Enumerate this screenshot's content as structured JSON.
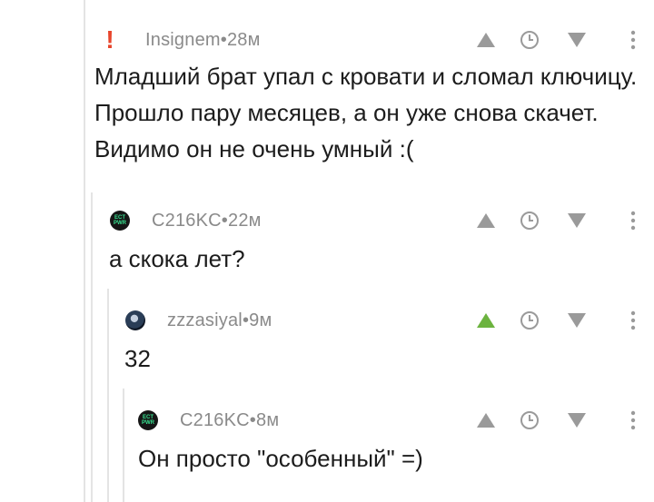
{
  "comments": [
    {
      "author": "Insignem",
      "time": "28м",
      "avatar_icon": "exclamation-icon",
      "text": "Младший брат упал с кровати и сломал ключицу. Прошло пару месяцев, а он уже снова скачет. Видимо он не очень умный :(",
      "upvoted": false
    },
    {
      "author": "C216KC",
      "time": "22м",
      "avatar_icon": "ect-pwr-avatar",
      "avatar_text": [
        "ECT",
        "PWR"
      ],
      "text": "а скока лет?",
      "upvoted": false
    },
    {
      "author": "zzzasiyal",
      "time": "9м",
      "avatar_icon": "user-avatar",
      "text": "32",
      "upvoted": true
    },
    {
      "author": "C216KC",
      "time": "8м",
      "avatar_icon": "ect-pwr-avatar",
      "avatar_text": [
        "ECT",
        "PWR"
      ],
      "text": "Он просто \"особенный\" =)",
      "upvoted": false
    }
  ],
  "separator": " • ",
  "colors": {
    "upvote_active": "#6cb33f",
    "icon_gray": "#9a9a9a",
    "meta_gray": "#8a8a8a",
    "accent_red": "#e8452c",
    "thread_line": "#e4e4e4"
  }
}
